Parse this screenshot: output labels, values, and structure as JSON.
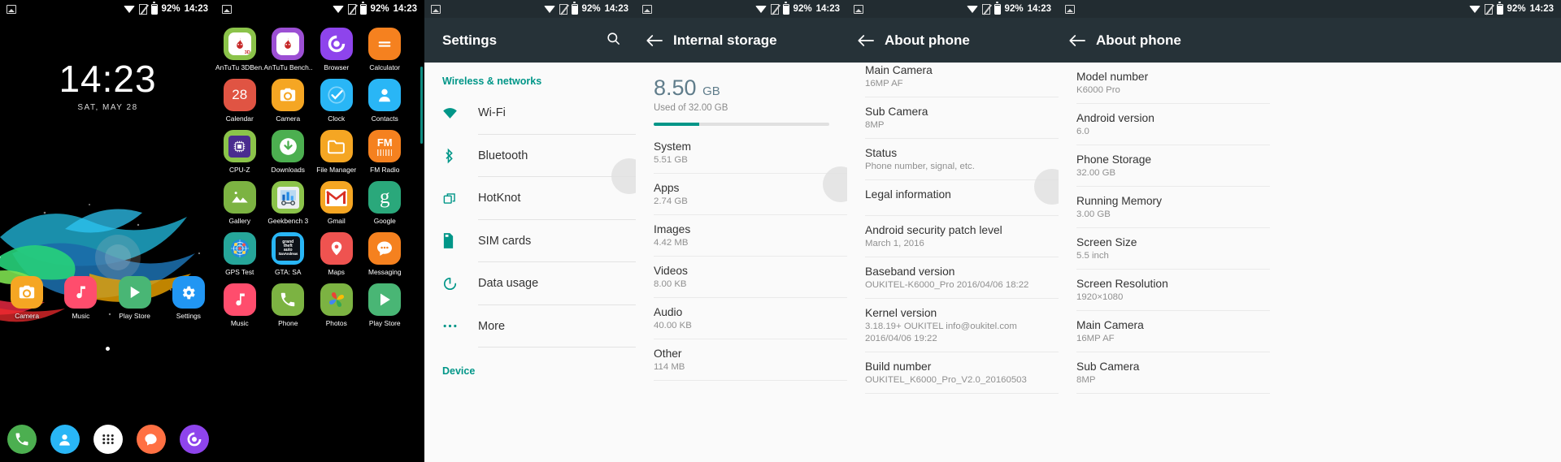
{
  "statusbar": {
    "photo_icon": "photo-icon",
    "wifi_icon": "wifi-icon",
    "sim_icon": "no-sim-icon",
    "battery_icon": "battery-icon",
    "battery": "92%",
    "time": "14:23"
  },
  "home": {
    "clock_time": "14:23",
    "clock_date": "SAT, MAY 28",
    "dock": [
      {
        "label": "Camera",
        "icon": "camera-icon",
        "color": "#f5a623"
      },
      {
        "label": "Music",
        "icon": "music-icon",
        "color": "#ff4d6d"
      },
      {
        "label": "Play Store",
        "icon": "play-store-icon",
        "color": "#49b675"
      },
      {
        "label": "Settings",
        "icon": "settings-gear-icon",
        "color": "#2196f3"
      }
    ],
    "navbar": [
      {
        "name": "phone-nav-icon",
        "color": "#4caf50"
      },
      {
        "name": "contacts-nav-icon",
        "color": "#29b6f6"
      },
      {
        "name": "app-drawer-nav-icon",
        "color": "#ffffff"
      },
      {
        "name": "messaging-nav-icon",
        "color": "#ff7043"
      },
      {
        "name": "browser-nav-icon",
        "color": "#8e44ec"
      }
    ]
  },
  "drawer": {
    "apps": [
      {
        "label": "AnTuTu 3DBen..",
        "icon": "antutu-3d-icon",
        "color": "#8bc34a"
      },
      {
        "label": "AnTuTu Bench..",
        "icon": "antutu-icon",
        "color": "#9c4fd4"
      },
      {
        "label": "Browser",
        "icon": "browser-icon",
        "color": "#8e44ec"
      },
      {
        "label": "Calculator",
        "icon": "calculator-icon",
        "color": "#f5811f"
      },
      {
        "label": "Calendar",
        "icon": "calendar-icon",
        "color": "#e05443",
        "badge": "28"
      },
      {
        "label": "Camera",
        "icon": "camera-icon",
        "color": "#f5a623"
      },
      {
        "label": "Clock",
        "icon": "clock-icon",
        "color": "#29b6f6"
      },
      {
        "label": "Contacts",
        "icon": "contacts-icon",
        "color": "#29b6f6"
      },
      {
        "label": "CPU-Z",
        "icon": "cpu-z-icon",
        "color": "#8bc34a"
      },
      {
        "label": "Downloads",
        "icon": "downloads-icon",
        "color": "#4caf50"
      },
      {
        "label": "File Manager",
        "icon": "file-manager-icon",
        "color": "#f5a623"
      },
      {
        "label": "FM Radio",
        "icon": "fm-radio-icon",
        "color": "#f5811f"
      },
      {
        "label": "Gallery",
        "icon": "gallery-icon",
        "color": "#7cb342"
      },
      {
        "label": "Geekbench 3",
        "icon": "geekbench-icon",
        "color": "#8bc34a"
      },
      {
        "label": "Gmail",
        "icon": "gmail-icon",
        "color": "#f5a623"
      },
      {
        "label": "Google",
        "icon": "google-icon",
        "color": "#2aa87b"
      },
      {
        "label": "GPS Test",
        "icon": "gps-test-icon",
        "color": "#26a69a"
      },
      {
        "label": "GTA: SA",
        "icon": "gta-sa-icon",
        "color": "#29b6f6"
      },
      {
        "label": "Maps",
        "icon": "maps-icon",
        "color": "#ef5350"
      },
      {
        "label": "Messaging",
        "icon": "messaging-icon",
        "color": "#f5811f"
      },
      {
        "label": "Music",
        "icon": "music-icon",
        "color": "#ff4d6d"
      },
      {
        "label": "Phone",
        "icon": "phone-icon",
        "color": "#7cb342"
      },
      {
        "label": "Photos",
        "icon": "photos-icon",
        "color": "#7cb342"
      },
      {
        "label": "Play Store",
        "icon": "play-store-icon",
        "color": "#49b675"
      }
    ]
  },
  "settings": {
    "title": "Settings",
    "search_icon": "search-icon",
    "section_wireless": "Wireless & networks",
    "section_device": "Device",
    "rows": [
      {
        "label": "Wi-Fi",
        "icon": "wifi-icon"
      },
      {
        "label": "Bluetooth",
        "icon": "bluetooth-icon"
      },
      {
        "label": "HotKnot",
        "icon": "hotknot-icon"
      },
      {
        "label": "SIM cards",
        "icon": "sim-card-icon"
      },
      {
        "label": "Data usage",
        "icon": "data-usage-icon"
      },
      {
        "label": "More",
        "icon": "more-dots-icon"
      }
    ]
  },
  "storage": {
    "title": "Internal storage",
    "back_icon": "back-arrow-icon",
    "used_value": "8.50",
    "used_unit": "GB",
    "used_of": "Used of 32.00 GB",
    "progress_percent": 26,
    "rows": [
      {
        "key": "System",
        "value": "5.51 GB"
      },
      {
        "key": "Apps",
        "value": "2.74 GB"
      },
      {
        "key": "Images",
        "value": "4.42 MB"
      },
      {
        "key": "Videos",
        "value": "8.00 KB"
      },
      {
        "key": "Audio",
        "value": "40.00 KB"
      },
      {
        "key": "Other",
        "value": "114 MB"
      }
    ]
  },
  "about_a": {
    "title": "About phone",
    "back_icon": "back-arrow-icon",
    "rows": [
      {
        "key": "Main Camera",
        "value": "16MP AF"
      },
      {
        "key": "Sub Camera",
        "value": "8MP"
      },
      {
        "key": "Status",
        "value": "Phone number, signal, etc."
      },
      {
        "key": "Legal information",
        "value": ""
      },
      {
        "key": "Android security patch level",
        "value": "March 1, 2016"
      },
      {
        "key": "Baseband version",
        "value": "OUKITEL-K6000_Pro 2016/04/06 18:22"
      },
      {
        "key": "Kernel version",
        "value": "3.18.19+ OUKITEL info@oukitel.com 2016/04/06 19:22"
      },
      {
        "key": "Build number",
        "value": "OUKITEL_K6000_Pro_V2.0_20160503"
      }
    ]
  },
  "about_b": {
    "title": "About phone",
    "back_icon": "back-arrow-icon",
    "rows": [
      {
        "key": "Model number",
        "value": "K6000 Pro"
      },
      {
        "key": "Android version",
        "value": "6.0"
      },
      {
        "key": "Phone Storage",
        "value": "32.00 GB"
      },
      {
        "key": "Running Memory",
        "value": "3.00 GB"
      },
      {
        "key": "Screen Size",
        "value": "5.5 inch"
      },
      {
        "key": "Screen Resolution",
        "value": "1920×1080"
      },
      {
        "key": "Main Camera",
        "value": "16MP AF"
      },
      {
        "key": "Sub Camera",
        "value": "8MP"
      }
    ]
  },
  "colors": {
    "accent": "#009688",
    "appbar": "#263238",
    "page": "#fafafa"
  }
}
